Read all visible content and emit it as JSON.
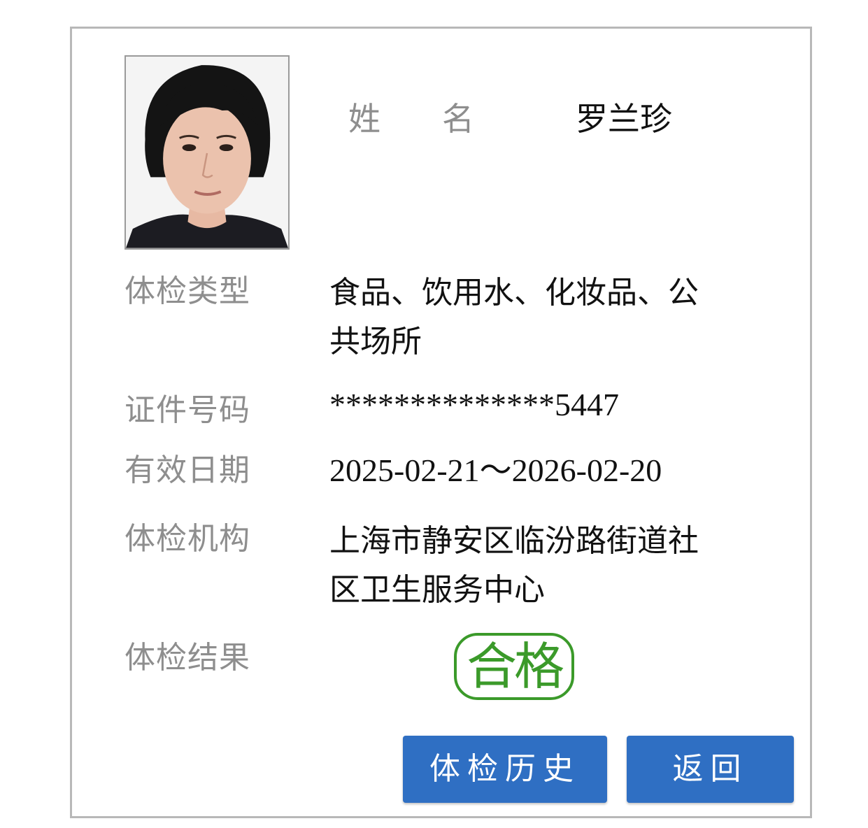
{
  "profile": {
    "name_label_chars": [
      "姓",
      "名"
    ],
    "name": "罗兰珍"
  },
  "fields": {
    "exam_type_label": "体检类型",
    "exam_type_line1": "食品、饮用水、化妆品、公",
    "exam_type_line2": "共场所",
    "id_label": "证件号码",
    "id_value": "**************5447",
    "validity_label": "有效日期",
    "validity_value": "2025-02-21～2026-02-20",
    "institution_label": "体检机构",
    "institution_line1": "上海市静安区临汾路街道社",
    "institution_line2": "区卫生服务中心",
    "result_label": "体检结果",
    "result_value": "合格"
  },
  "buttons": {
    "history": "体检历史",
    "back": "返回"
  },
  "colors": {
    "primary_button": "#2f6fc3",
    "pass_stamp": "#3b9a2a",
    "label_gray": "#8e8e8e"
  }
}
